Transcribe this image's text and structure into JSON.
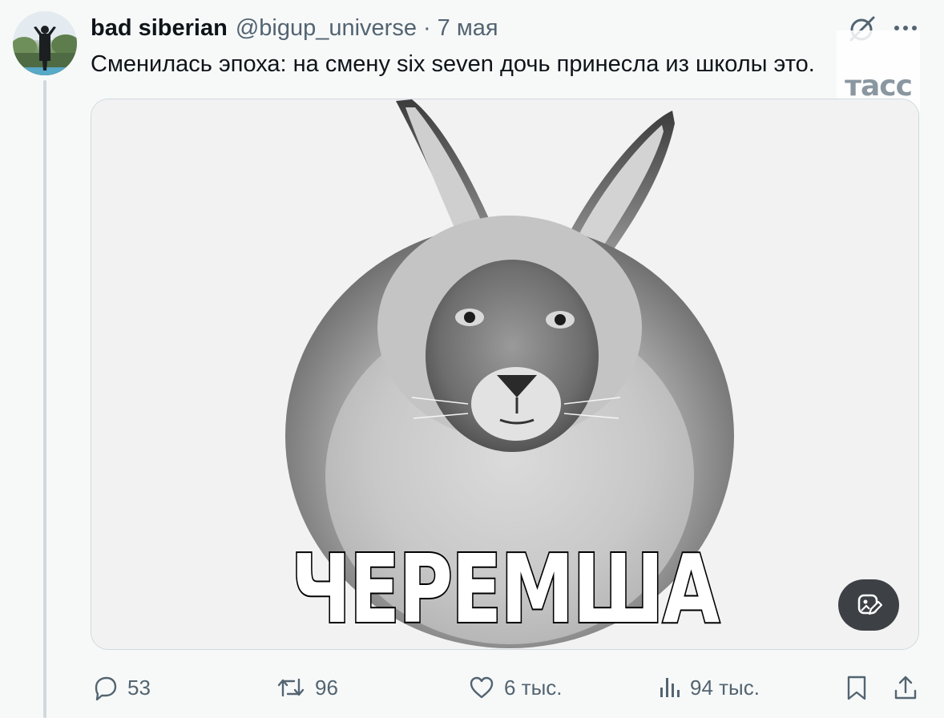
{
  "tweet": {
    "display_name": "bad siberian",
    "handle": "@bigup_universe",
    "separator": "·",
    "date": "7 мая",
    "text": "Сменилась эпоха: на смену six seven дочь принесла из школы это.",
    "image_caption": "ЧЕРЕМША"
  },
  "watermark": {
    "text": "тасс"
  },
  "actions": {
    "replies": "53",
    "reposts": "96",
    "likes": "6 тыс.",
    "views": "94 тыс."
  },
  "icons": {
    "grok": "grok-icon",
    "more": "more-icon",
    "reply": "reply-icon",
    "repost": "repost-icon",
    "like": "heart-icon",
    "views": "views-icon",
    "bookmark": "bookmark-icon",
    "share": "share-icon",
    "edit_image": "edit-image-icon"
  },
  "colors": {
    "text_primary": "#0f1419",
    "text_secondary": "#536471",
    "border": "#cfd9de",
    "background": "#f7f9f9"
  }
}
